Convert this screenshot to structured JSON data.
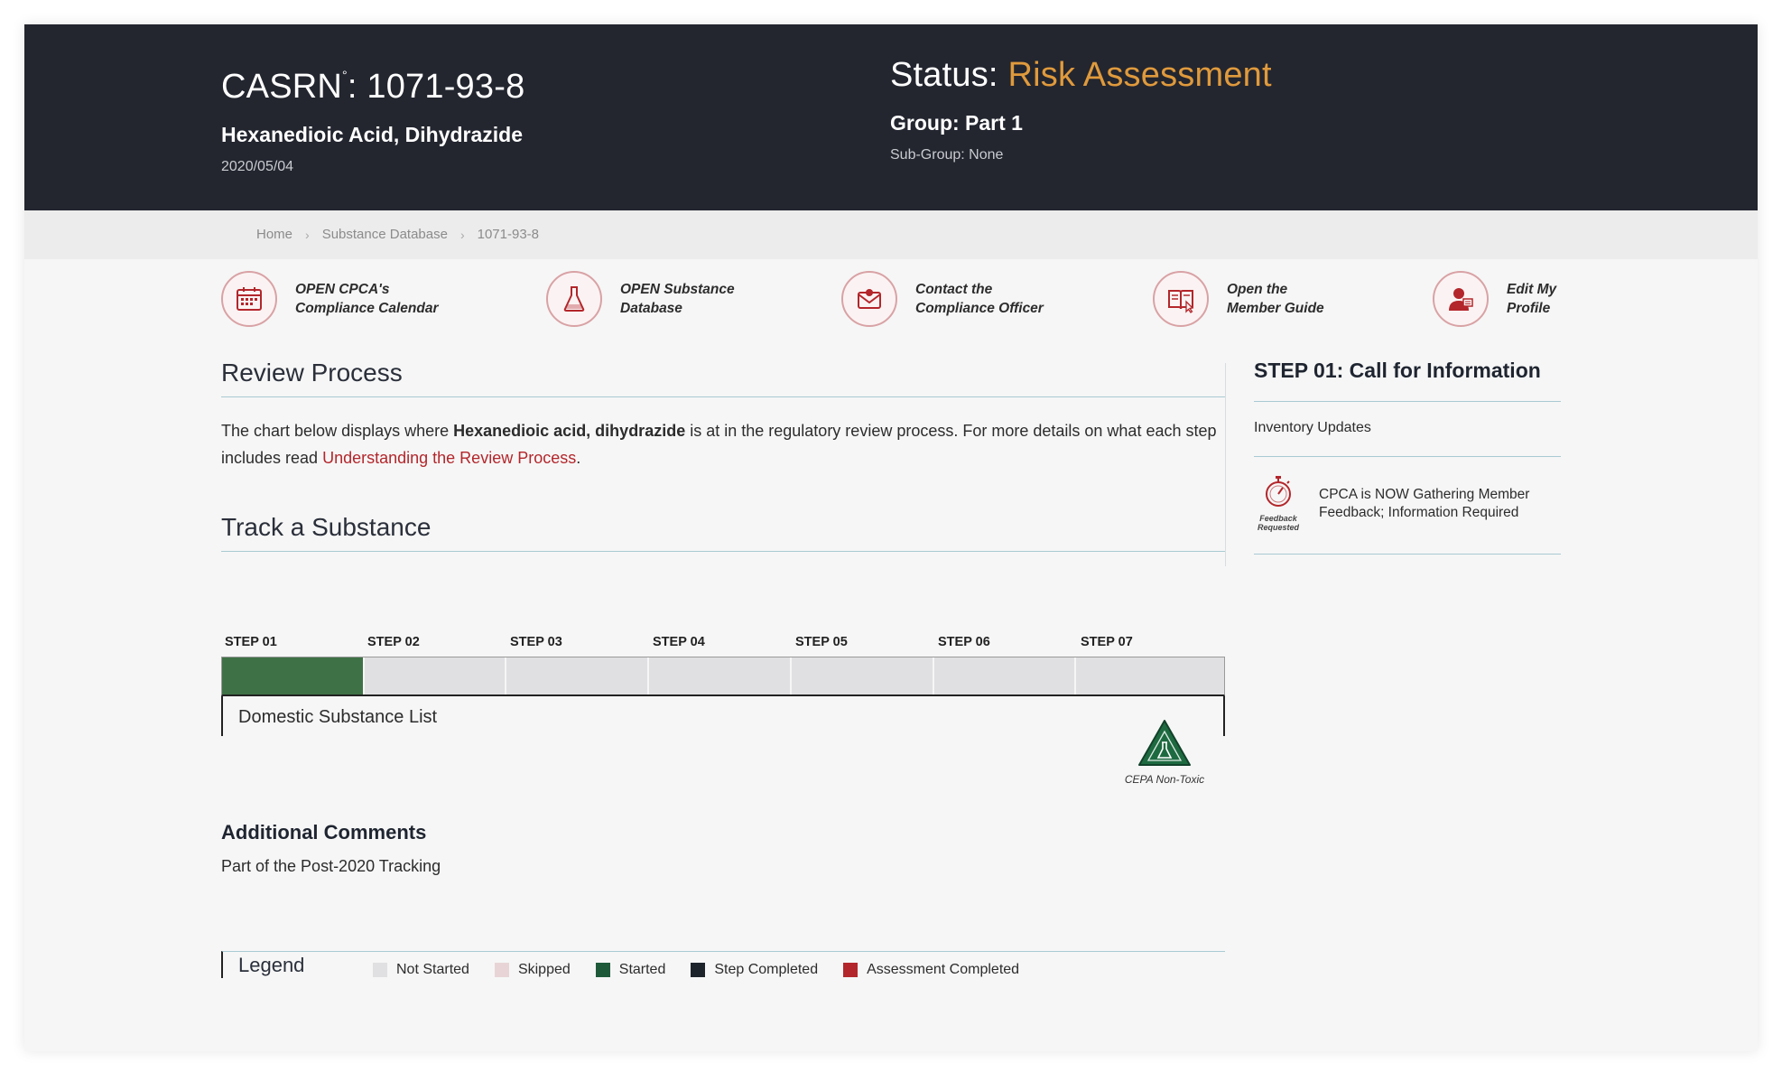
{
  "header": {
    "casrn_label": "CASRN",
    "casrn_sup": "°",
    "casrn_value": ": 1071-93-8",
    "substance_name": "Hexanedioic Acid, Dihydrazide",
    "date": "2020/05/04",
    "status_label": "Status: ",
    "status_value": "Risk Assessment",
    "group": "Group: Part 1",
    "subgroup": "Sub-Group: None",
    "colors": {
      "background": "#23262f",
      "accent": "#e09a3c"
    }
  },
  "breadcrumb": {
    "items": [
      "Home",
      "Substance Database",
      "1071-93-8"
    ],
    "separator": "›"
  },
  "quick_links": [
    {
      "icon": "calendar-icon",
      "line1": "OPEN CPCA's",
      "line2": "Compliance Calendar"
    },
    {
      "icon": "flask-icon",
      "line1": "OPEN Substance",
      "line2": "Database"
    },
    {
      "icon": "envelope-icon",
      "line1": "Contact the",
      "line2": "Compliance Officer"
    },
    {
      "icon": "book-icon",
      "line1": "Open the",
      "line2": "Member Guide"
    },
    {
      "icon": "user-profile-icon",
      "line1": "Edit My",
      "line2": "Profile"
    }
  ],
  "review": {
    "title": "Review Process",
    "intro_before": "The chart below displays where ",
    "intro_bold": "Hexanedioic acid, dihydrazide",
    "intro_after": " is at in the regulatory review process. For more details on what each step includes read ",
    "intro_link": "Understanding the Review Process",
    "intro_end": "."
  },
  "track": {
    "title": "Track a Substance",
    "steps": [
      {
        "label": "STEP 01",
        "state": "Started"
      },
      {
        "label": "STEP 02",
        "state": "Not Started"
      },
      {
        "label": "STEP 03",
        "state": "Not Started"
      },
      {
        "label": "STEP 04",
        "state": "Not Started"
      },
      {
        "label": "STEP 05",
        "state": "Not Started"
      },
      {
        "label": "STEP 06",
        "state": "Not Started"
      },
      {
        "label": "STEP 07",
        "state": "Not Started"
      }
    ],
    "list_name": "Domestic Substance List",
    "cepa_label": "CEPA Non-Toxic"
  },
  "comments": {
    "title": "Additional Comments",
    "text": "Part of the Post-2020 Tracking"
  },
  "legend": {
    "title": "Legend",
    "items": [
      {
        "label": "Not Started",
        "color": "#e0dfe1"
      },
      {
        "label": "Skipped",
        "color": "#e8d4d6"
      },
      {
        "label": "Started",
        "color": "#1e5a3a"
      },
      {
        "label": "Step Completed",
        "color": "#1c232b"
      },
      {
        "label": "Assessment Completed",
        "color": "#b3262b"
      }
    ]
  },
  "sidebar": {
    "title": "STEP 01: Call for Information",
    "update": "Inventory Updates",
    "feedback_icon_text_1": "Feedback",
    "feedback_icon_text_2": "Requested",
    "feedback_text": "CPCA is NOW Gathering Member Feedback; Information Required"
  }
}
